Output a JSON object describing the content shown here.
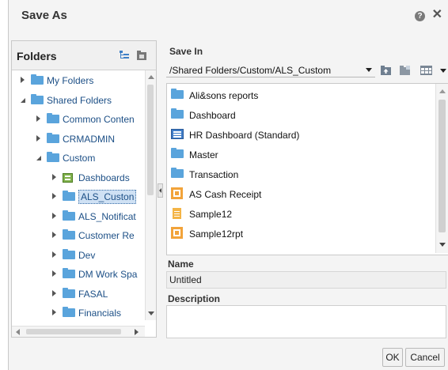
{
  "dialog": {
    "title": "Save As",
    "help_icon": "help-icon",
    "close_icon": "close-icon"
  },
  "folders": {
    "title": "Folders",
    "tree": [
      {
        "label": "My Folders",
        "level": 0,
        "state": "collapsed",
        "icon": "folder-icon"
      },
      {
        "label": "Shared Folders",
        "level": 0,
        "state": "expanded",
        "icon": "folder-icon"
      },
      {
        "label": "Common Conten",
        "level": 1,
        "state": "collapsed",
        "icon": "folder-icon"
      },
      {
        "label": "CRMADMIN",
        "level": 1,
        "state": "collapsed",
        "icon": "folder-icon"
      },
      {
        "label": "Custom",
        "level": 1,
        "state": "expanded",
        "icon": "folder-icon"
      },
      {
        "label": "Dashboards",
        "level": 2,
        "state": "collapsed",
        "icon": "dashboard-folder-icon"
      },
      {
        "label": "ALS_Custon",
        "level": 2,
        "state": "collapsed",
        "icon": "folder-icon",
        "selected": true
      },
      {
        "label": "ALS_Notificat",
        "level": 2,
        "state": "collapsed",
        "icon": "folder-icon"
      },
      {
        "label": "Customer Re",
        "level": 2,
        "state": "collapsed",
        "icon": "folder-icon"
      },
      {
        "label": "Dev",
        "level": 2,
        "state": "collapsed",
        "icon": "folder-icon"
      },
      {
        "label": "DM Work Spa",
        "level": 2,
        "state": "collapsed",
        "icon": "folder-icon"
      },
      {
        "label": "FASAL",
        "level": 2,
        "state": "collapsed",
        "icon": "folder-icon"
      },
      {
        "label": "Financials",
        "level": 2,
        "state": "collapsed",
        "icon": "folder-icon"
      }
    ]
  },
  "save_in": {
    "label": "Save In",
    "path": "/Shared Folders/Custom/ALS_Custom",
    "toolbar_icons": [
      "folder-up-icon",
      "new-folder-icon",
      "view-options-icon"
    ]
  },
  "files": [
    {
      "label": "Ali&sons reports",
      "icon": "folder-icon"
    },
    {
      "label": "Dashboard",
      "icon": "folder-icon"
    },
    {
      "label": "HR Dashboard (Standard)",
      "icon": "dashboard-icon"
    },
    {
      "label": "Master",
      "icon": "folder-icon"
    },
    {
      "label": "Transaction",
      "icon": "folder-icon"
    },
    {
      "label": "AS Cash Receipt",
      "icon": "report-icon"
    },
    {
      "label": "Sample12",
      "icon": "document-icon"
    },
    {
      "label": "Sample12rpt",
      "icon": "report-icon"
    }
  ],
  "name_field": {
    "label": "Name",
    "value": "Untitled"
  },
  "description_field": {
    "label": "Description",
    "value": ""
  },
  "buttons": {
    "ok": "OK",
    "cancel": "Cancel"
  }
}
